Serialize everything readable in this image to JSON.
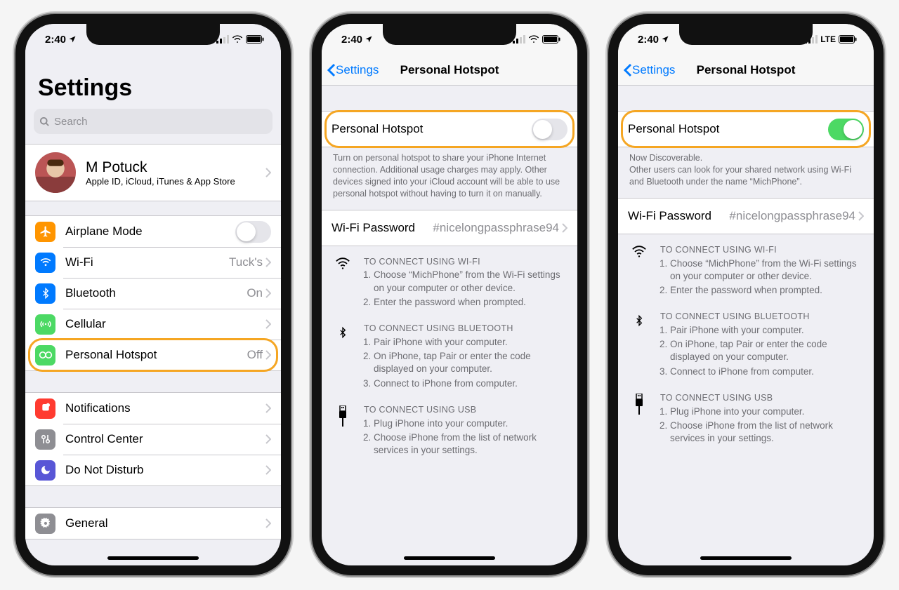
{
  "status": {
    "time": "2:40",
    "network_tag_lte": "LTE"
  },
  "s1": {
    "title": "Settings",
    "search_placeholder": "Search",
    "profile": {
      "name": "M Potuck",
      "sub": "Apple ID, iCloud, iTunes & App Store"
    },
    "items": {
      "airplane": {
        "label": "Airplane Mode"
      },
      "wifi": {
        "label": "Wi-Fi",
        "value": "Tuck's"
      },
      "bluetooth": {
        "label": "Bluetooth",
        "value": "On"
      },
      "cellular": {
        "label": "Cellular"
      },
      "hotspot": {
        "label": "Personal Hotspot",
        "value": "Off"
      },
      "notifications": {
        "label": "Notifications"
      },
      "control": {
        "label": "Control Center"
      },
      "dnd": {
        "label": "Do Not Disturb"
      },
      "general": {
        "label": "General"
      }
    }
  },
  "s2": {
    "back": "Settings",
    "title": "Personal Hotspot",
    "toggle_label": "Personal Hotspot",
    "hint": "Turn on personal hotspot to share your iPhone Internet connection. Additional usage charges may apply. Other devices signed into your iCloud account will be able to use personal hotspot without having to turn it on manually.",
    "wifi_pw_label": "Wi-Fi Password",
    "wifi_pw_value": "#nicelongpassphrase94",
    "instr": {
      "wifi_title": "TO CONNECT USING WI-FI",
      "wifi_1": "Choose “MichPhone” from the Wi-Fi settings on your computer or other device.",
      "wifi_2": "Enter the password when prompted.",
      "bt_title": "TO CONNECT USING BLUETOOTH",
      "bt_1": "Pair iPhone with your computer.",
      "bt_2": "On iPhone, tap Pair or enter the code displayed on your computer.",
      "bt_3": "Connect to iPhone from computer.",
      "usb_title": "TO CONNECT USING USB",
      "usb_1": "Plug iPhone into your computer.",
      "usb_2": "Choose iPhone from the list of network services in your settings."
    }
  },
  "s3": {
    "back": "Settings",
    "title": "Personal Hotspot",
    "toggle_label": "Personal Hotspot",
    "discoverable": "Now Discoverable.",
    "hint": "Other users can look for your shared network using Wi-Fi and Bluetooth under the name “MichPhone”.",
    "wifi_pw_label": "Wi-Fi Password",
    "wifi_pw_value": "#nicelongpassphrase94"
  },
  "colors": {
    "orange": "#ff9500",
    "blue": "#007aff",
    "green": "#4cd964",
    "grey": "#8e8e93",
    "red": "#ff3b30",
    "purple": "#5856d6"
  }
}
